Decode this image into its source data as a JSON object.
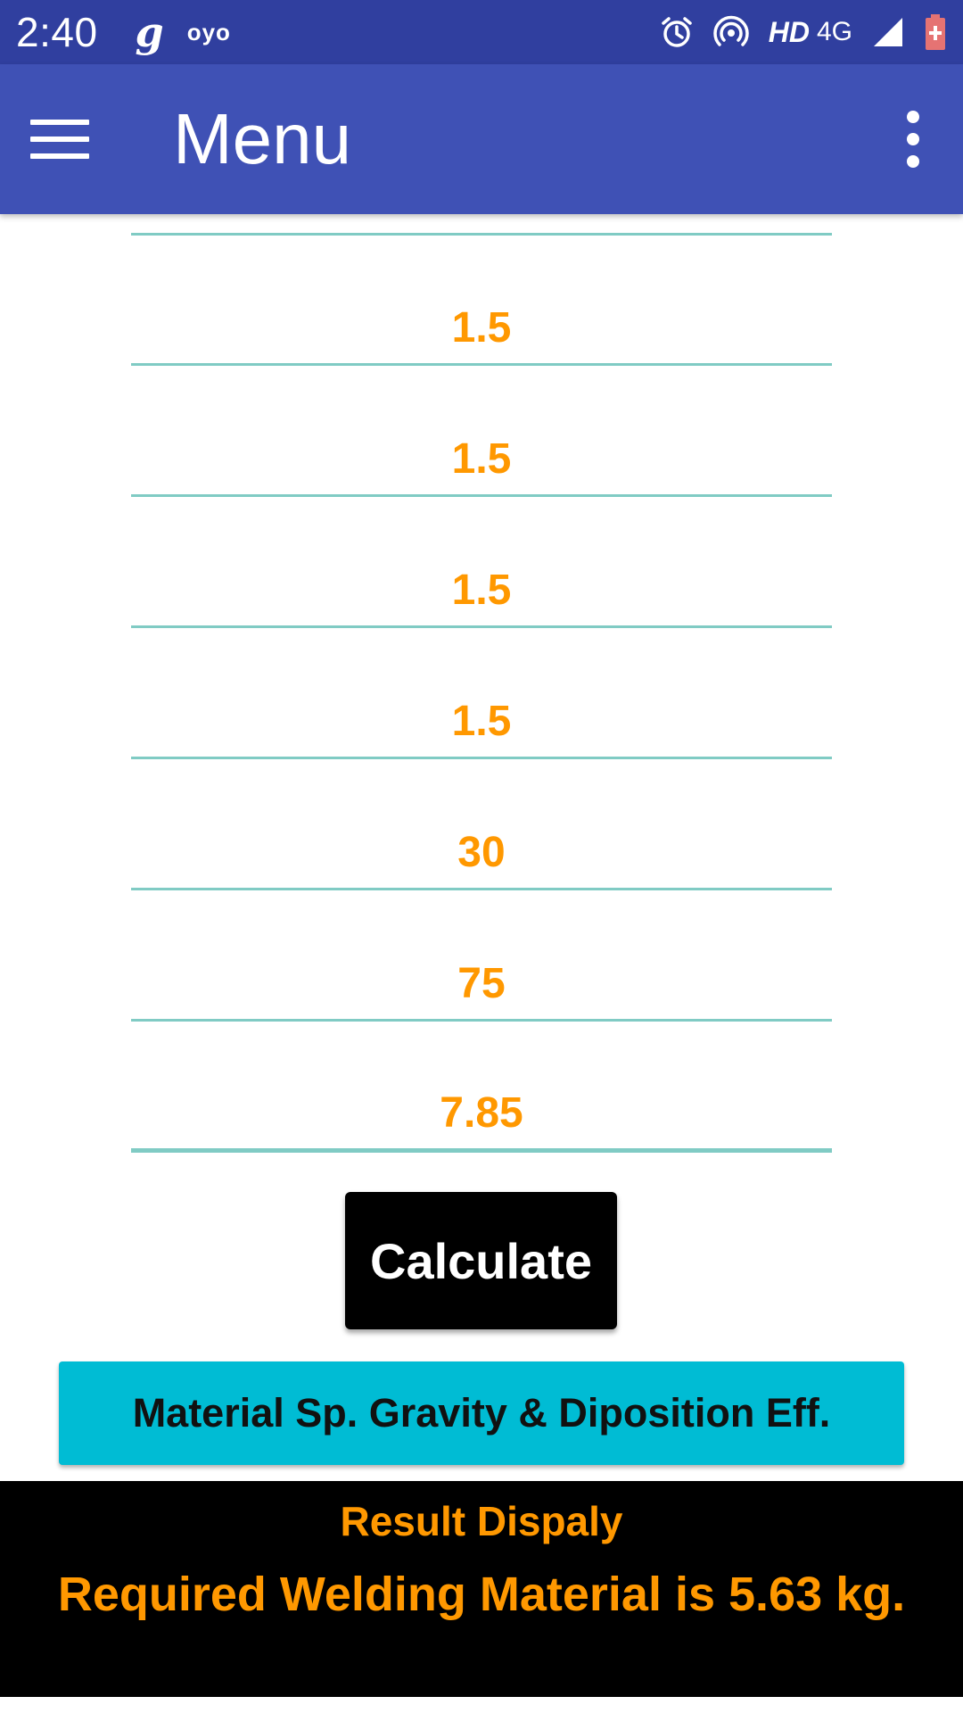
{
  "status_bar": {
    "time": "2:40",
    "notif_g": "g",
    "notif_oyo": "oyo",
    "hd": "HD",
    "network": "4G",
    "icons": [
      "alarm-icon",
      "hotspot-icon",
      "signal-icon",
      "battery-icon"
    ]
  },
  "app_bar": {
    "title": "Menu",
    "menu_icon": "hamburger-icon",
    "overflow_icon": "more-vert-icon",
    "background": "#3f51b5",
    "status_background": "#303f9f"
  },
  "fields": [
    {
      "value": "1.5"
    },
    {
      "value": "1.5"
    },
    {
      "value": "1.5"
    },
    {
      "value": "1.5"
    },
    {
      "value": "30"
    },
    {
      "value": "75"
    },
    {
      "value": "7.85"
    }
  ],
  "calculate_label": "Calculate",
  "info_button_label": "Material Sp. Gravity & Diposition Eff.",
  "result": {
    "title": "Result Dispaly",
    "text": "Required Welding Material is 5.63 kg."
  },
  "colors": {
    "accent_text": "#ff9800",
    "underline": "#80cbc4",
    "info_button": "#00bcd4",
    "result_bg": "#000000"
  }
}
